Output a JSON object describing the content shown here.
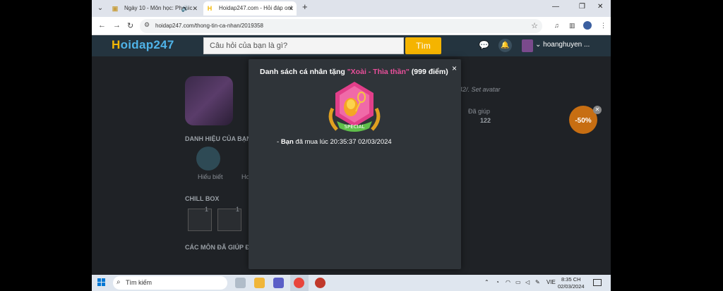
{
  "browser": {
    "tabs": [
      {
        "title": "Ngày 10 - Môn học: Phonic"
      },
      {
        "title": "Hoidap247.com - Hỏi đáp onl"
      }
    ],
    "new_tab": "+",
    "url": "hoidap247.com/thong-tin-ca-nhan/2019358"
  },
  "site": {
    "logo_h": "H",
    "logo_rest": "oidap247",
    "search_placeholder": "Câu hỏi của bạn là gì?",
    "search_button": "Tìm",
    "username": "hoanghuyen ..."
  },
  "background": {
    "section_titles": [
      "DANH HIỆU CỦA BẠN",
      "CHILL BOX",
      "CÁC MÔN ĐÃ GIÚP ĐỠ"
    ],
    "badge_labels": [
      "Hiếu biết",
      "Ho"
    ],
    "helped_label": "Đã giúp",
    "helped_value": "122",
    "bio_snippet": "42/. Set avatar",
    "chill_counts": [
      "1",
      "1"
    ],
    "promo_value": "-50%"
  },
  "modal": {
    "title_prefix": "Danh sách cá nhân tặng",
    "gift_name": "\"Xoài - Thìa thần\"",
    "points": "(999 điểm)",
    "close": "×",
    "medal_ribbon": "SPECIAL",
    "buyer_prefix": "- ",
    "buyer": "Bạn",
    "purchase_text": " đã mua lúc 20:35:37 02/03/2024"
  },
  "taskbar": {
    "search_label": "Tìm kiếm",
    "language": "VIE",
    "time": "8:35 CH",
    "date": "02/03/2024"
  },
  "colors": {
    "accent": "#f5b400",
    "logo_blue": "#4fb3e8",
    "gift_pink": "#e94f9b",
    "modal_bg": "#2f3439"
  }
}
